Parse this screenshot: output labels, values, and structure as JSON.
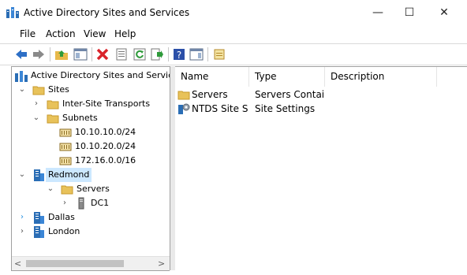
{
  "window": {
    "title": "Active Directory Sites and Services",
    "minimize": "—",
    "maximize": "☐",
    "close": "✕"
  },
  "menu": [
    "File",
    "Action",
    "View",
    "Help"
  ],
  "toolbar": [
    "back-icon",
    "forward-icon",
    "up-folder-icon",
    "show-hide-tree-icon",
    "delete-icon",
    "properties-icon",
    "refresh-icon",
    "export-list-icon",
    "help-icon",
    "show-hide-action-pane-icon",
    "new-object-icon"
  ],
  "tree": {
    "root": "Active Directory Sites and Services",
    "sites": "Sites",
    "inter_site": "Inter-Site Transports",
    "subnets": "Subnets",
    "subnet_items": [
      "10.10.10.0/24",
      "10.10.20.0/24",
      "172.16.0.0/16"
    ],
    "redmond": "Redmond",
    "servers": "Servers",
    "dc1": "DC1",
    "dallas": "Dallas",
    "london": "London"
  },
  "list": {
    "columns": [
      "Name",
      "Type",
      "Description"
    ],
    "rows": [
      {
        "name": "Servers",
        "type": "Servers Contai...",
        "description": "",
        "icon": "folder-icon"
      },
      {
        "name": "NTDS Site Se...",
        "type": "Site Settings",
        "description": "",
        "icon": "ntds-settings-icon"
      }
    ]
  },
  "scroll": {
    "left": "<",
    "right": ">"
  }
}
